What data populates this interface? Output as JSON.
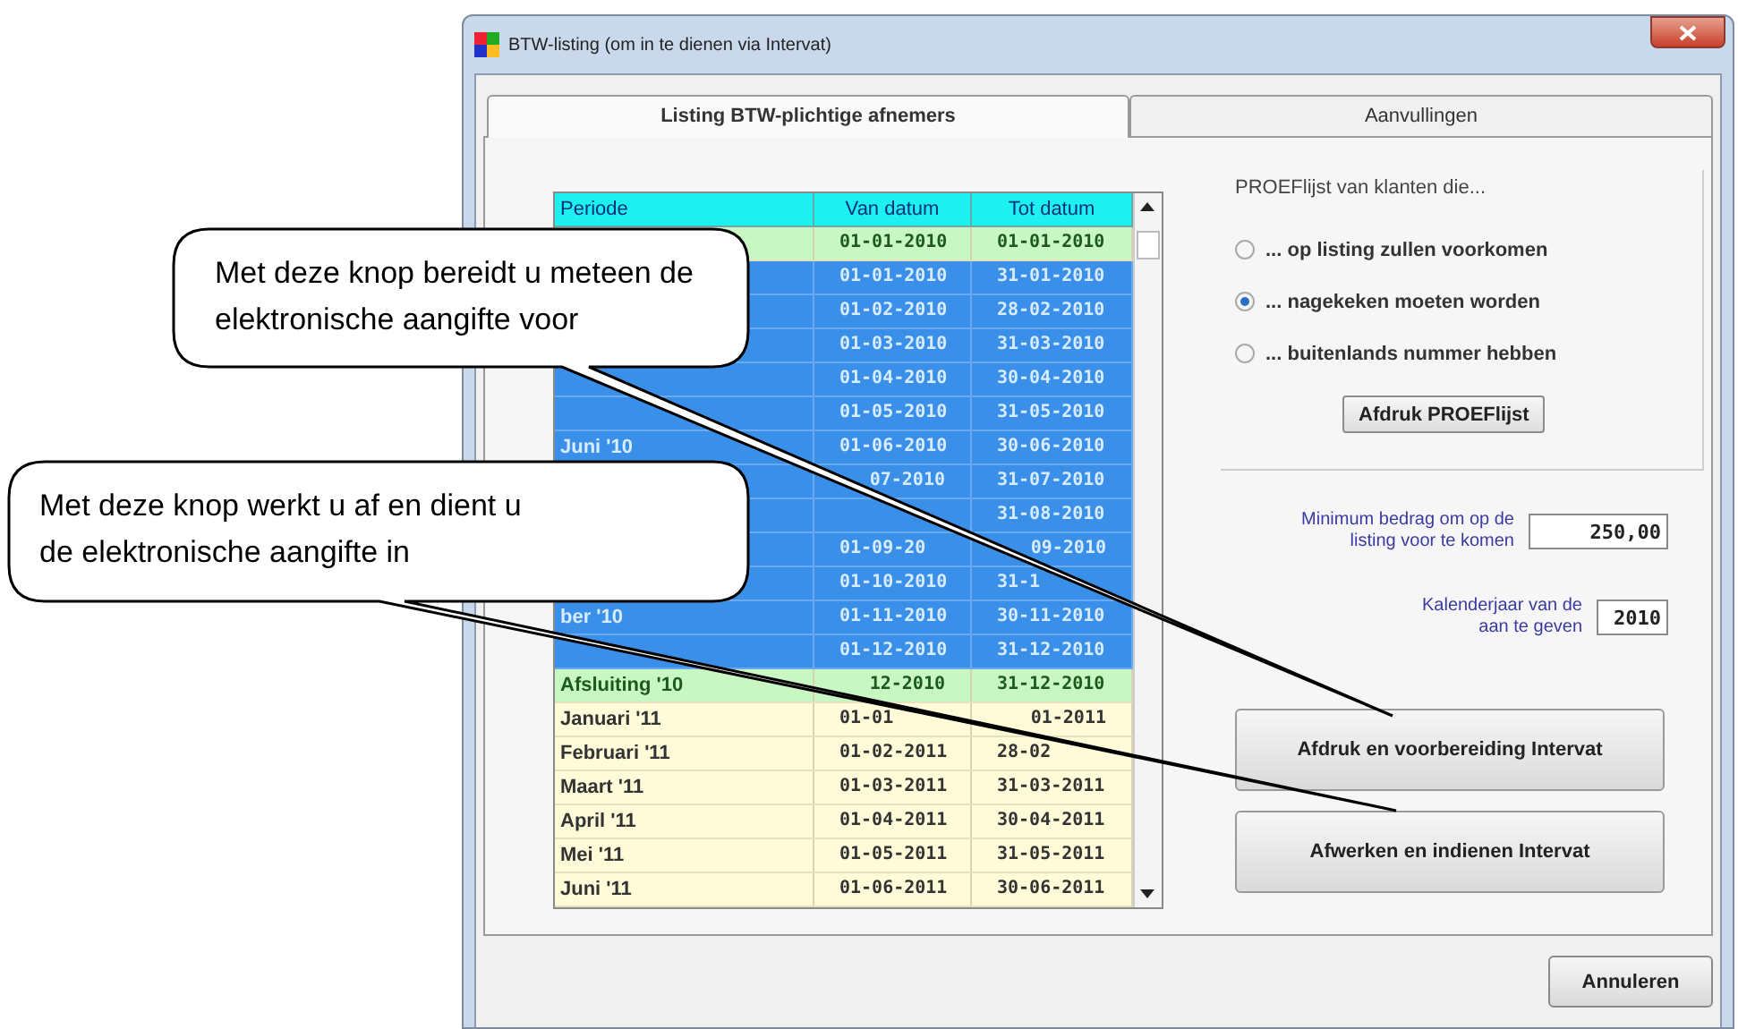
{
  "window": {
    "title": "BTW-listing (om in te dienen via Intervat)"
  },
  "tabs": [
    {
      "label": "Listing BTW-plichtige afnemers",
      "selected": true
    },
    {
      "label": "Aanvullingen",
      "selected": false
    }
  ],
  "table": {
    "columns": [
      "Periode",
      "Van datum",
      "Tot datum"
    ],
    "rows": [
      {
        "kind": "opening",
        "selected": false,
        "van": "01-01-2010",
        "tot": "01-01-2010"
      },
      {
        "kind": "period",
        "selected": true,
        "van": "01-01-2010",
        "tot": "31-01-2010"
      },
      {
        "kind": "period",
        "selected": true,
        "van": "01-02-2010",
        "tot": "28-02-2010"
      },
      {
        "kind": "period",
        "selected": true,
        "van": "01-03-2010",
        "tot": "31-03-2010"
      },
      {
        "kind": "period",
        "selected": true,
        "van": "01-04-2010",
        "tot": "30-04-2010"
      },
      {
        "kind": "period",
        "selected": true,
        "van": "01-05-2010",
        "tot": "31-05-2010"
      },
      {
        "kind": "period",
        "selected": true,
        "periode": "Juni '10",
        "van": "01-06-2010",
        "tot": "30-06-2010"
      },
      {
        "kind": "period",
        "selected": true,
        "van": "07-2010",
        "tot": "31-07-2010"
      },
      {
        "kind": "period",
        "selected": true,
        "tot": "31-08-2010"
      },
      {
        "kind": "period",
        "selected": true,
        "van": "01-09-20",
        "tot": "09-2010"
      },
      {
        "kind": "period",
        "selected": true,
        "van": "01-10-2010",
        "tot": "31-1"
      },
      {
        "kind": "period",
        "selected": true,
        "periode": "ber '10",
        "van": "01-11-2010",
        "tot": "30-11-2010"
      },
      {
        "kind": "period",
        "selected": true,
        "van": "01-12-2010",
        "tot": "31-12-2010"
      },
      {
        "kind": "closing",
        "selected": false,
        "periode": "Afsluiting '10",
        "van": "12-2010",
        "tot": "31-12-2010"
      },
      {
        "kind": "period",
        "selected": false,
        "periode": "Januari '11",
        "van": "01-01",
        "tot": "01-2011"
      },
      {
        "kind": "period",
        "selected": false,
        "periode": "Februari '11",
        "van": "01-02-2011",
        "tot": "28-02"
      },
      {
        "kind": "period",
        "selected": false,
        "periode": "Maart '11",
        "van": "01-03-2011",
        "tot": "31-03-2011"
      },
      {
        "kind": "period",
        "selected": false,
        "periode": "April '11",
        "van": "01-04-2011",
        "tot": "30-04-2011"
      },
      {
        "kind": "period",
        "selected": false,
        "periode": "Mei '11",
        "van": "01-05-2011",
        "tot": "31-05-2011"
      },
      {
        "kind": "period",
        "selected": false,
        "periode": "Juni '11",
        "van": "01-06-2011",
        "tot": "30-06-2011"
      }
    ]
  },
  "proef": {
    "title": "PROEFlijst van klanten die...",
    "options": [
      {
        "label": "... op listing zullen voorkomen",
        "selected": false
      },
      {
        "label": "... nagekeken moeten worden",
        "selected": true
      },
      {
        "label": "... buitenlands nummer hebben",
        "selected": false
      }
    ],
    "button": "Afdruk PROEFlijst"
  },
  "fields": [
    {
      "label": "Minimum bedrag om op de listing voor te komen",
      "value": "250,00"
    },
    {
      "label": "Kalenderjaar van de aan te geven",
      "value": "2010"
    }
  ],
  "actions": [
    "Afdruk en voorbereiding Intervat",
    "Afwerken en indienen Intervat"
  ],
  "cancel": "Annuleren",
  "callouts": [
    "Met deze knop bereidt u meteen de elektronische aangifte voor",
    "Met deze knop werkt u af en dient u de elektronische aangifte in"
  ]
}
